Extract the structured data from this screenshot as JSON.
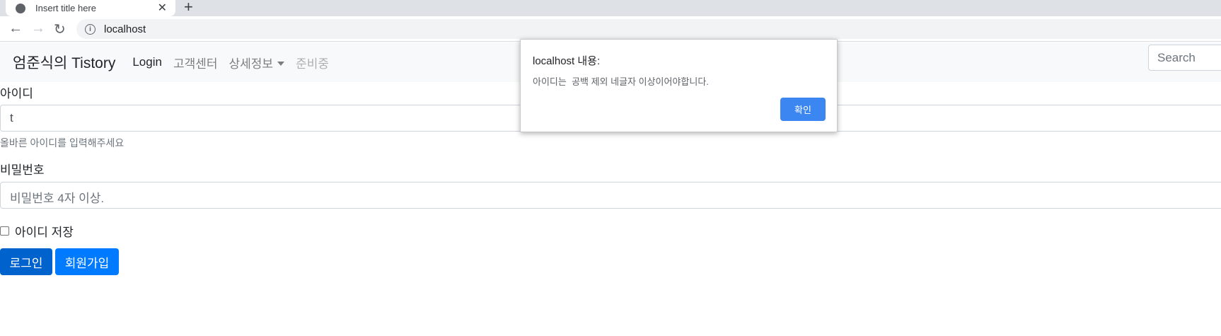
{
  "browser": {
    "tab_title": "Insert title here",
    "url": "localhost"
  },
  "navbar": {
    "brand": "엄준식의 Tistory",
    "links": [
      "Login",
      "고객센터",
      "상세정보",
      "준비중"
    ],
    "search_placeholder": "Search"
  },
  "form": {
    "id_label": "아이디",
    "id_value": "t",
    "id_help": "올바른 아이디를 입력해주세요",
    "pw_label": "비밀번호",
    "pw_placeholder": "비밀번호 4자 이상.",
    "remember_label": "아이디 저장",
    "login_button": "로그인",
    "signup_button": "회원가입"
  },
  "dialog": {
    "title": "localhost 내용:",
    "message": "아이디는  공백 제외 네글자 이상이어야합니다.",
    "ok": "확인"
  },
  "colors": {
    "primary": "#007bff",
    "primary_active": "#0062cc",
    "dialog_button": "#3b86f0"
  }
}
